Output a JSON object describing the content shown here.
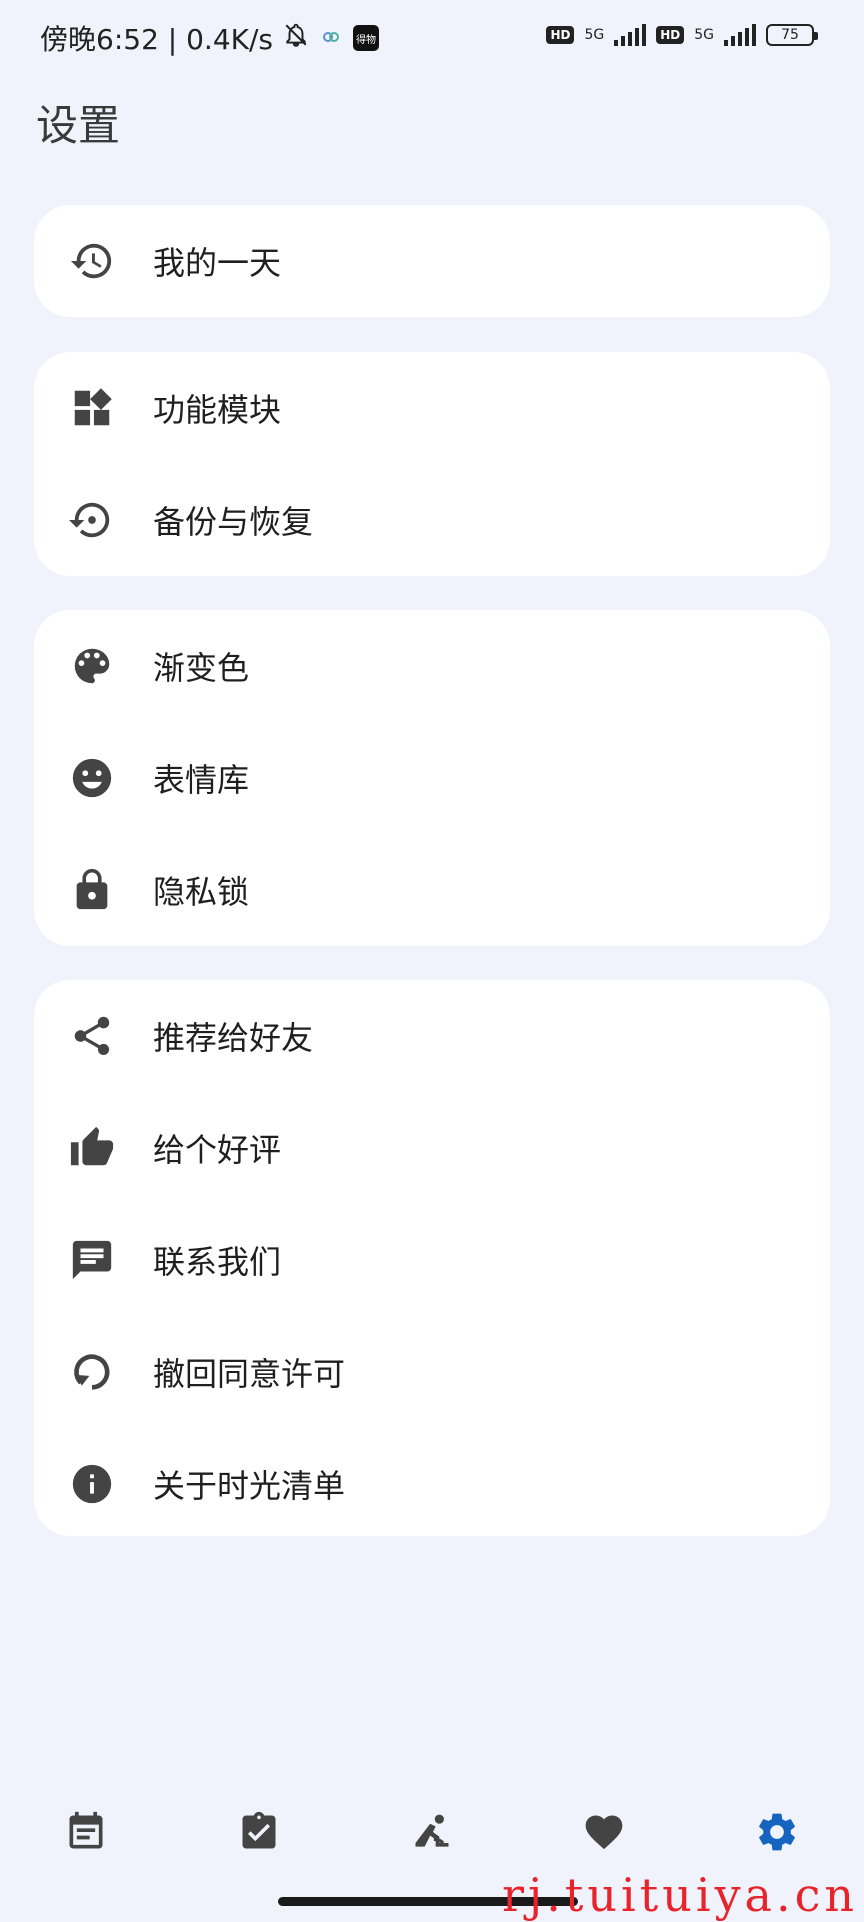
{
  "status_bar": {
    "time": "傍晚6:52 | 0.4K/s",
    "app_badge": "得物",
    "hd1": "HD",
    "net1": "5G",
    "hd2": "HD",
    "net2": "5G",
    "battery": "75"
  },
  "page": {
    "title": "设置"
  },
  "groups": [
    {
      "items": [
        {
          "label": "我的一天",
          "icon": "history-icon"
        }
      ]
    },
    {
      "items": [
        {
          "label": "功能模块",
          "icon": "widgets-icon"
        },
        {
          "label": "备份与恢复",
          "icon": "restore-icon"
        }
      ]
    },
    {
      "items": [
        {
          "label": "渐变色",
          "icon": "palette-icon"
        },
        {
          "label": "表情库",
          "icon": "smiley-icon"
        },
        {
          "label": "隐私锁",
          "icon": "lock-icon"
        }
      ]
    },
    {
      "items": [
        {
          "label": "推荐给好友",
          "icon": "share-icon"
        },
        {
          "label": "给个好评",
          "icon": "thumbs-up-icon"
        },
        {
          "label": "联系我们",
          "icon": "chat-icon"
        },
        {
          "label": "撤回同意许可",
          "icon": "revoke-icon"
        },
        {
          "label": "关于时光清单",
          "icon": "info-icon"
        }
      ]
    }
  ],
  "bottom_nav": [
    {
      "icon": "calendar-icon",
      "active": false
    },
    {
      "icon": "task-check-icon",
      "active": false
    },
    {
      "icon": "meditation-icon",
      "active": false
    },
    {
      "icon": "heart-icon",
      "active": false
    },
    {
      "icon": "settings-gear-icon",
      "active": true
    }
  ],
  "watermark": "rj.tuituiya.cn",
  "colors": {
    "background": "#f0f3fb",
    "card": "#ffffff",
    "icon": "#444444",
    "active_tab": "#1565c0"
  }
}
